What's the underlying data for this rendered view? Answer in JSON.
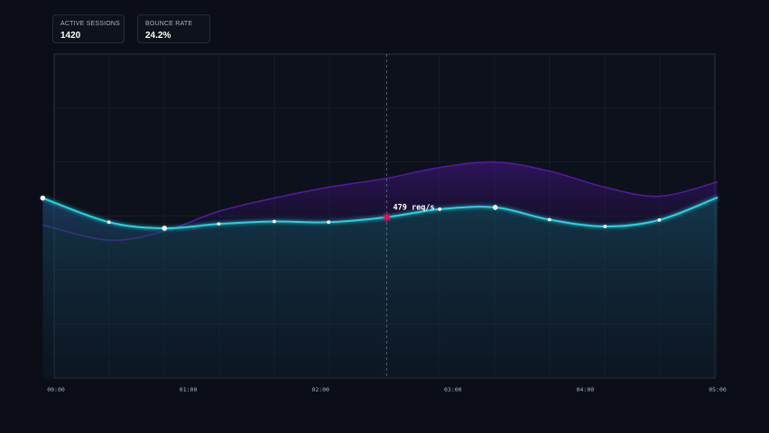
{
  "stats": [
    {
      "label": "ACTIVE SESSIONS",
      "value": "1420"
    },
    {
      "label": "BOUNCE RATE",
      "value": "24.2%"
    }
  ],
  "chart_data": {
    "type": "line",
    "title": "",
    "xlabel": "",
    "ylabel": "",
    "x_tick_labels": [
      "00:00",
      "01:00",
      "02:00",
      "03:00",
      "04:00",
      "05:00"
    ],
    "xlim": [
      -0.1,
      5.0
    ],
    "ylim": [
      0,
      900
    ],
    "grid": true,
    "series": [
      {
        "color": "#27d3de",
        "x": [
          -0.1,
          0.4,
          0.82,
          1.23,
          1.65,
          2.06,
          2.5,
          2.9,
          3.32,
          3.73,
          4.15,
          4.56,
          5.0
        ],
        "y": [
          500,
          433,
          416,
          428,
          435,
          433,
          447,
          469,
          474,
          440,
          421,
          439,
          502
        ],
        "markers": [
          true,
          true,
          true,
          true,
          true,
          true,
          false,
          true,
          true,
          true,
          true,
          true,
          false
        ]
      },
      {
        "color": "#6a22c8",
        "x": [
          -0.1,
          0.4,
          0.82,
          1.23,
          1.65,
          2.06,
          2.5,
          2.9,
          3.32,
          3.73,
          4.15,
          4.56,
          5.0
        ],
        "y": [
          425,
          383,
          408,
          463,
          500,
          530,
          555,
          585,
          600,
          575,
          530,
          505,
          545
        ]
      }
    ],
    "crosshair_x": 2.5,
    "highlight": {
      "x": 2.5,
      "y": 447,
      "label": "479 req/s",
      "color": "#e0115f"
    }
  }
}
